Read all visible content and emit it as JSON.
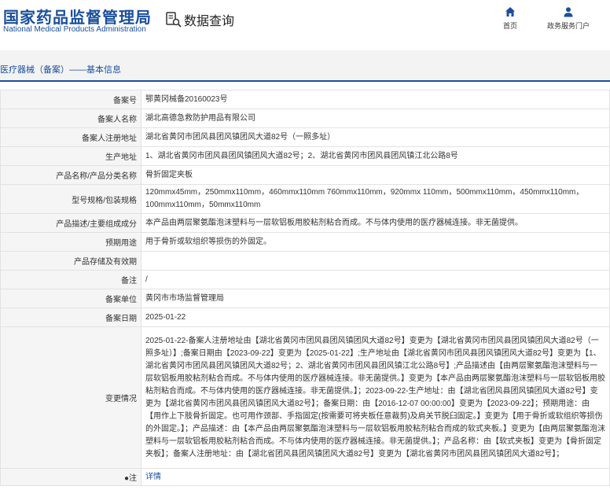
{
  "header": {
    "brand_cn": "国家药品监督管理局",
    "brand_en": "National Medical Products Administration",
    "query_label": "数据查询",
    "nav": [
      {
        "label": "首页",
        "icon": "home-icon"
      },
      {
        "label": "政务服务门户",
        "icon": "user-icon"
      }
    ]
  },
  "breadcrumb": "医疗器械（备案）——基本信息",
  "rows": [
    {
      "key": "备案号",
      "value": "鄂黄冈械备20160023号"
    },
    {
      "key": "备案人名称",
      "value": "湖北高德急救防护用品有限公司"
    },
    {
      "key": "备案人注册地址",
      "value": "湖北省黄冈市团风县团风镇团风大道82号（一照多址）"
    },
    {
      "key": "生产地址",
      "value": "1、湖北省黄冈市团风县团风镇团风大道82号；2、湖北省黄冈市团风县团风镇江北公路8号"
    },
    {
      "key": "产品名称/产品分类名称",
      "value": "骨折固定夹板"
    },
    {
      "key": "型号规格/包装规格",
      "value": "120mmx45mm，250mmx110mm，460mmx110mm 760mmx110mm，920mmx 110mm，500mmx110mm，450mmx110mm，100mmx110mm，50mmx110mm"
    },
    {
      "key": "产品描述/主要组成成分",
      "value": "本产品由两层聚氨酯泡沫塑料与一层软铝板用胶粘剂粘合而成。不与体内使用的医疗器械连接。非无菌提供。"
    },
    {
      "key": "预期用途",
      "value": "用于骨折或软组织等损伤的外固定。"
    },
    {
      "key": "产品存储及有效期",
      "value": ""
    },
    {
      "key": "备注",
      "value": "/"
    },
    {
      "key": "备案单位",
      "value": "黄冈市市场监督管理局"
    },
    {
      "key": "备案日期",
      "value": "2025-01-22"
    },
    {
      "key": "变更情况",
      "value": "2025-01-22-备案人注册地址由【湖北省黄冈市团风县团风镇团风大道82号】变更为【湖北省黄冈市团风县团风镇团风大道82号（一照多址）】;备案日期由【2023-09-22】变更为【2025-01-22】;生产地址由【湖北省黄冈市团风县团风镇团风大道82号】变更为【1、湖北省黄冈市团风县团风镇团风大道82号；2、湖北省黄冈市团风县团风镇江北公路8号】;产品描述由【由两层聚氨酯泡沫塑料与一层软铝板用胶粘剂粘合而成。不与体内使用的医疗器械连接。非无菌提供。】变更为【本产品由两层聚氨酯泡沫塑料与一层软铝板用胶粘剂粘合而成。不与体内使用的医疗器械连接。非无菌提供。】；2023-09-22-生产地址：由【湖北省团风县团风镇团风大道82号】变更为【湖北省黄冈市团风县团风镇团风大道82号】；备案日期：由【2016-12-07 00:00:00】变更为【2023-09-22】；预期用途：由【用作上下肢骨折固定。也可用作颈部、手指固定(按需要可将夹板任意裁剪)及肩关节脱臼固定。】变更为【用于骨折或软组织等损伤的外固定。】；产品描述：由【本产品由两层聚氨酯泡沫塑料与一层软铝板用胶粘剂粘合而成的软式夹板。】变更为【由两层聚氨酯泡沫塑料与一层软铝板用胶粘剂粘合而成。不与体内使用的医疗器械连接。非无菌提供。】；产品名称：由【软式夹板】变更为【骨折固定夹板】；备案人注册地址：由【湖北省团风县团风镇团风大道82号】变更为【湖北省黄冈市团风县团风镇团风大道82号】；"
    },
    {
      "key": "●注",
      "value": "详情",
      "link": true
    }
  ]
}
